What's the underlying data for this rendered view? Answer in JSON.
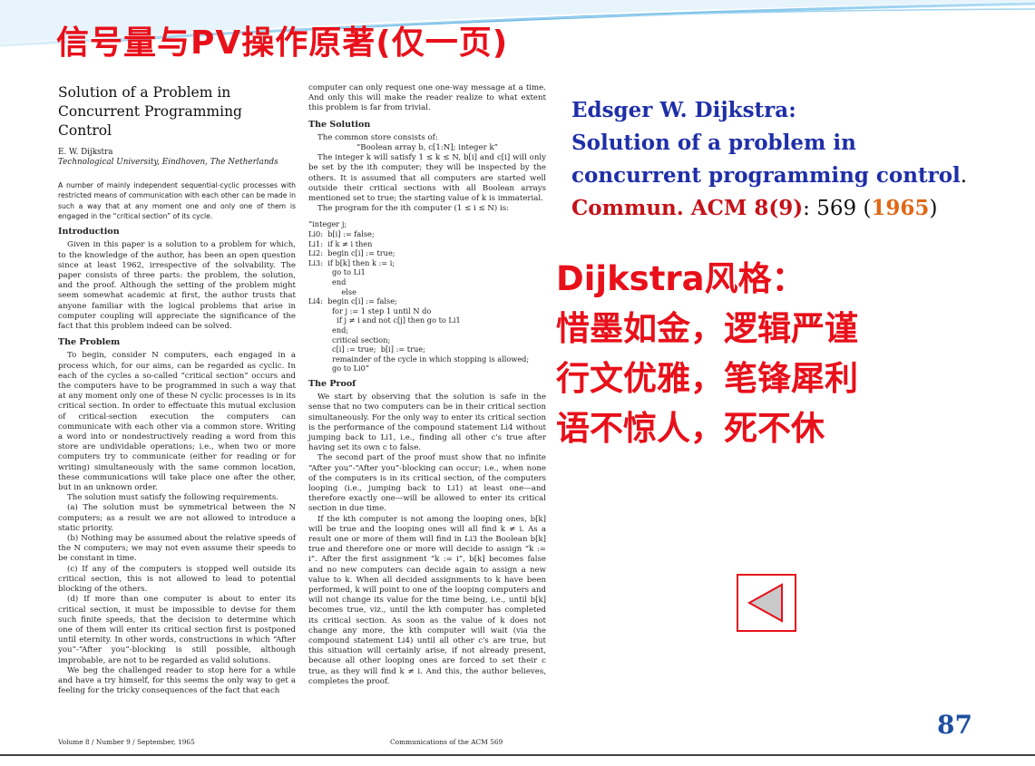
{
  "slide": {
    "title": "信号量与PV操作原著(仅一页)",
    "page_number": "87"
  },
  "reference": {
    "author": "Edsger W. Dijkstra:",
    "title_line1": "Solution of a problem in",
    "title_line2": "concurrent programming control",
    "title_end": ".",
    "journal": "Commun. ACM 8(9)",
    "pages": ": 569 (",
    "year": "1965",
    "close": ")"
  },
  "style": {
    "heading": "Dijkstra风格：",
    "line1": "惜墨如金，逻辑严谨",
    "line2": "行文优雅，笔锋犀利",
    "line3": "语不惊人，死不休"
  },
  "paper": {
    "title1": "Solution of a Problem in",
    "title2": "Concurrent Programming Control",
    "author": "E. W. Dijkstra",
    "affiliation": "Technological University, Eindhoven, The Netherlands",
    "abstract": "A number of mainly independent sequential-cyclic processes with restricted means of communication with each other can be made in such a way that at any moment one and only one of them is engaged in the “critical section” of its cycle.",
    "intro_head": "Introduction",
    "intro": "Given in this paper is a solution to a problem for which, to the knowledge of the author, has been an open question since at least 1962, irrespective of the solvability. The paper consists of three parts: the problem, the solution, and the proof. Although the setting of the problem might seem somewhat academic at first, the author trusts that anyone familiar with the logical problems that arise in computer coupling will appreciate the significance of the fact that this problem indeed can be solved.",
    "problem_head": "The Problem",
    "problem1": "To begin, consider N computers, each engaged in a process which, for our aims, can be regarded as cyclic. In each of the cycles a so-called “critical section” occurs and the computers have to be programmed in such a way that at any moment only one of these N cyclic processes is in its critical section. In order to effectuate this mutual exclusion of critical-section execution the computers can communicate with each other via a common store. Writing a word into or nondestructively reading a word from this store are undividable operations; i.e., when two or more computers try to communicate (either for reading or for writing) simultaneously with the same common location, these communications will take place one after the other, but in an unknown order.",
    "problem2": "The solution must satisfy the following requirements.",
    "req_a": "(a) The solution must be symmetrical between the N computers; as a result we are not allowed to introduce a static priority.",
    "req_b": "(b) Nothing may be assumed about the relative speeds of the N computers; we may not even assume their speeds to be constant in time.",
    "req_c": "(c) If any of the computers is stopped well outside its critical section, this is not allowed to lead to potential blocking of the others.",
    "req_d": "(d) If more than one computer is about to enter its critical section, it must be impossible to devise for them such finite speeds, that the decision to determine which one of them will enter its critical section first is postponed until eternity. In other words, constructions in which “After you”-“After you”-blocking is still possible, although improbable, are not to be regarded as valid solutions.",
    "beg": "We beg the challenged reader to stop here for a while and have a try himself, for this seems the only way to get a feeling for the tricky consequences of the fact that each",
    "right_top": "computer can only request one one-way message at a time. And only this will make the reader realize to what extent this problem is far from trivial.",
    "solution_head": "The Solution",
    "solution1": "The common store consists of:",
    "solution_decl": "“Boolean array b, c[1:N]; integer k”",
    "solution2": "The integer k will satisfy 1 ≤ k ≤ N, b[i] and c[i] will only be set by the ith computer; they will be inspected by the others. It is assumed that all computers are started well outside their critical sections with all Boolean arrays mentioned set to true; the starting value of k is immaterial.",
    "solution3": "The program for the ith computer (1 ≤ i ≤ N) is:",
    "code": "“integer j;\nLi0:  b[i] := false;\nLi1:  if k ≠ i then\nLi2:  begin c[i] := true;\nLi3:  if b[k] then k := i;\n          go to Li1\n          end\n              else\nLi4:  begin c[i] := false;\n          for j := 1 step 1 until N do\n            if j ≠ i and not c[j] then go to Li1\n          end;\n          critical section;\n          c[i] := true;  b[i] := true;\n          remainder of the cycle in which stopping is allowed;\n          go to Li0”",
    "proof_head": "The Proof",
    "proof1": "We start by observing that the solution is safe in the sense that no two computers can be in their critical section simultaneously. For the only way to enter its critical section is the performance of the compound statement Li4 without jumping back to Li1, i.e., finding all other c's true after having set its own c to false.",
    "proof2": "The second part of the proof must show that no infinite “After you”-“After you”-blocking can occur; i.e., when none of the computers is in its critical section, of the computers looping (i.e., jumping back to Li1) at least one—and therefore exactly one—will be allowed to enter its critical section in due time.",
    "proof3": "If the kth computer is not among the looping ones, b[k] will be true and the looping ones will all find k ≠ i. As a result one or more of them will find in Li3 the Boolean b[k] true and therefore one or more will decide to assign “k := i”. After the first assignment “k := i”, b[k] becomes false and no new computers can decide again to assign a new value to k. When all decided assignments to k have been performed, k will point to one of the looping computers and will not change its value for the time being, i.e., until b[k] becomes true, viz., until the kth computer has completed its critical section. As soon as the value of k does not change any more, the kth computer will wait (via the compound statement Li4) until all other c's are true, but this situation will certainly arise, if not already present, because all other looping ones are forced to set their c true, as they will find k ≠ i. And this, the author believes, completes the proof.",
    "footer_left": "Volume 8 / Number 9 / September, 1965",
    "footer_right": "Communications of the ACM      569"
  }
}
